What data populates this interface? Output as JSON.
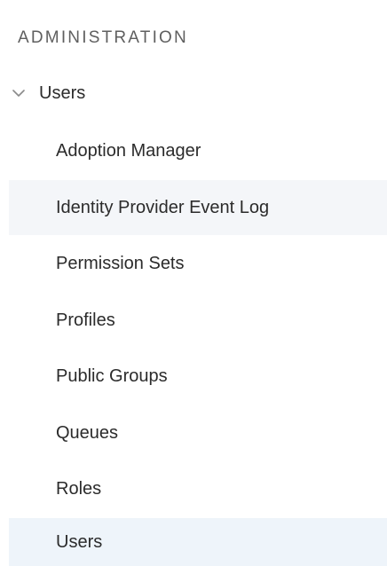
{
  "sidebar": {
    "section_title": "ADMINISTRATION",
    "group": {
      "label": "Users",
      "expanded": true,
      "icon": "chevron-down-icon"
    },
    "items": [
      {
        "label": "Adoption Manager"
      },
      {
        "label": "Identity Provider Event Log"
      },
      {
        "label": "Permission Sets"
      },
      {
        "label": "Profiles"
      },
      {
        "label": "Public Groups"
      },
      {
        "label": "Queues"
      },
      {
        "label": "Roles"
      },
      {
        "label": "Users"
      }
    ]
  },
  "colors": {
    "hover_background": "#f4f6f9",
    "selected_background": "#eef4fa",
    "text": "#2b2b2b",
    "section_title": "#5f5f5f"
  }
}
